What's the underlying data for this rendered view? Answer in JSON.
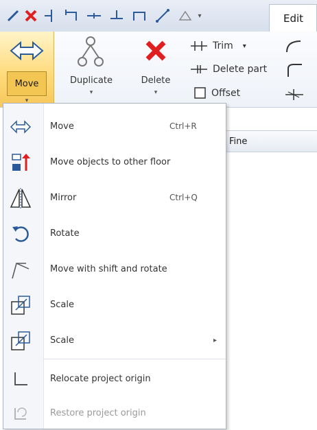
{
  "tab": {
    "edit_label": "Edit"
  },
  "ribbon": {
    "move_label": "Move",
    "duplicate_label": "Duplicate",
    "delete_label": "Delete",
    "trim_label": "Trim",
    "trim_dropdown": "▾",
    "delete_part_label": "Delete part",
    "offset_label": "Offset",
    "dropdown_arrow": "▾"
  },
  "menu": {
    "items": [
      {
        "label": "Move",
        "shortcut": "Ctrl+R",
        "icon": "move-arrows-icon"
      },
      {
        "label": "Move objects to other floor",
        "shortcut": "",
        "icon": "move-floor-icon"
      },
      {
        "label": "Mirror",
        "shortcut": "Ctrl+Q",
        "icon": "mirror-icon"
      },
      {
        "label": "Rotate",
        "shortcut": "",
        "icon": "rotate-icon"
      },
      {
        "label": "Move with shift and rotate",
        "shortcut": "",
        "icon": "shift-rotate-icon"
      },
      {
        "label": "Scale",
        "shortcut": "",
        "icon": "scale-icon"
      },
      {
        "label": "Scale",
        "shortcut": "",
        "submenu": "▸",
        "icon": "scale-icon"
      },
      {
        "label": "Relocate project origin",
        "shortcut": "",
        "icon": "origin-icon"
      },
      {
        "label": "Restore project origin",
        "shortcut": "",
        "icon": "restore-origin-icon"
      }
    ]
  },
  "table": {
    "header_fragment": "Fine"
  },
  "colors": {
    "accent": "#f6c75a",
    "delete_red": "#e02020",
    "icon_blue": "#2a5a9a"
  }
}
